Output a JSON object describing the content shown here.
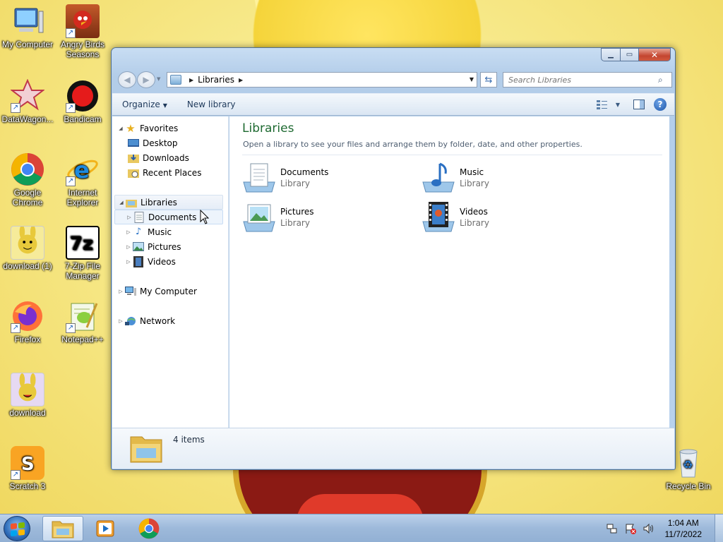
{
  "desktop": {
    "icons": [
      {
        "label": "My Computer",
        "icon": "computer-icon"
      },
      {
        "label": "Angry Birds Seasons",
        "icon": "angry-birds-icon"
      },
      {
        "label": "DataWagon...",
        "icon": "datawagon-icon"
      },
      {
        "label": "Bandicam",
        "icon": "bandicam-icon"
      },
      {
        "label": "Google Chrome",
        "icon": "chrome-icon"
      },
      {
        "label": "Internet Explorer",
        "icon": "ie-icon"
      },
      {
        "label": "download (1)",
        "icon": "image-file-icon"
      },
      {
        "label": "7-Zip File Manager",
        "icon": "7zip-icon"
      },
      {
        "label": "Firefox",
        "icon": "firefox-icon"
      },
      {
        "label": "Notepad++",
        "icon": "notepadpp-icon"
      },
      {
        "label": "download",
        "icon": "image-file-icon"
      },
      {
        "label": "Scratch 3",
        "icon": "scratch-icon"
      },
      {
        "label": "Recycle Bin",
        "icon": "recycle-bin-icon"
      }
    ]
  },
  "window": {
    "address": {
      "crumb": "Libraries"
    },
    "search": {
      "placeholder": "Search Libraries"
    },
    "toolbar": {
      "organize": "Organize",
      "new_library": "New library"
    },
    "nav": {
      "favorites": "Favorites",
      "desktop": "Desktop",
      "downloads": "Downloads",
      "recent_places": "Recent Places",
      "libraries": "Libraries",
      "documents": "Documents",
      "music": "Music",
      "pictures": "Pictures",
      "videos": "Videos",
      "my_computer": "My Computer",
      "network": "Network"
    },
    "content": {
      "title": "Libraries",
      "subtitle": "Open a library to see your files and arrange them by folder, date, and other properties.",
      "items": [
        {
          "name": "Documents",
          "kind": "Library"
        },
        {
          "name": "Music",
          "kind": "Library"
        },
        {
          "name": "Pictures",
          "kind": "Library"
        },
        {
          "name": "Videos",
          "kind": "Library"
        }
      ]
    },
    "details": {
      "count": "4 items"
    }
  },
  "taskbar": {
    "clock": {
      "time": "1:04 AM",
      "date": "11/7/2022"
    }
  },
  "colors": {
    "accent": "#1e6a31",
    "titlebar": "#b9d2ee",
    "taskbar": "#9db9da"
  }
}
